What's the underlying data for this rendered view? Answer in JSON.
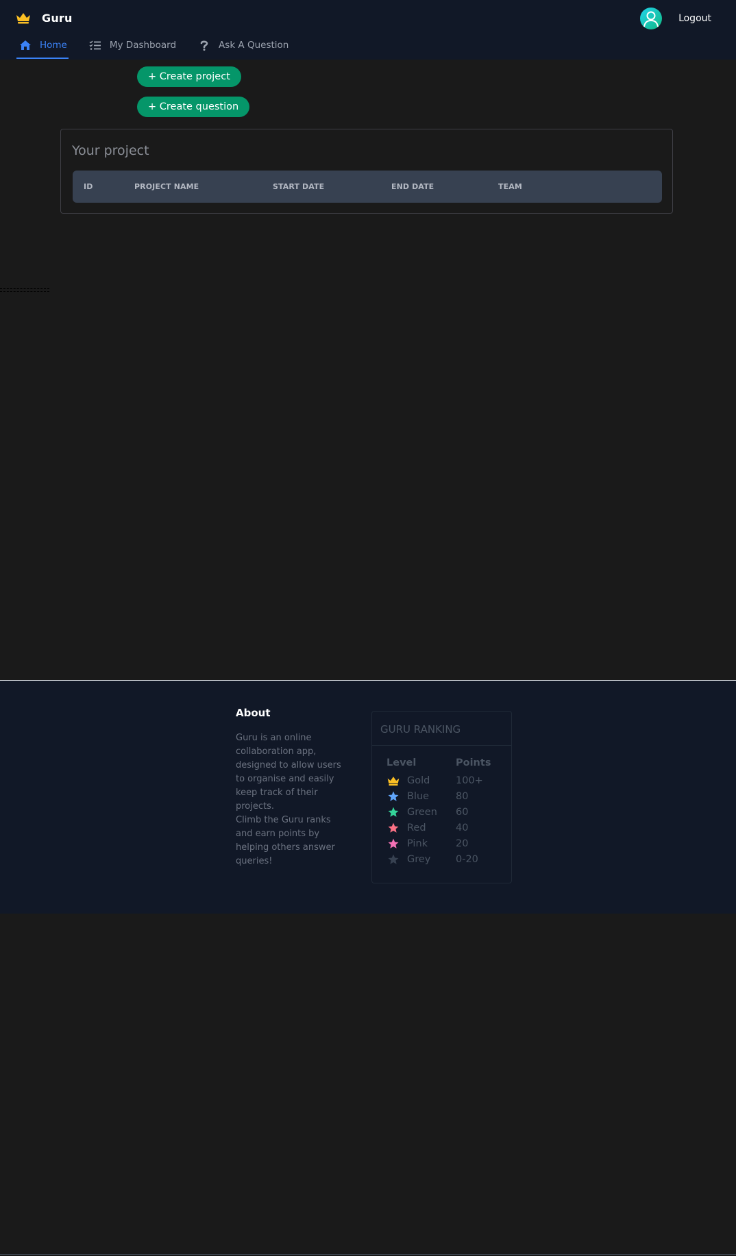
{
  "header": {
    "brand": "Guru",
    "logout_label": "Logout",
    "tabs": [
      {
        "label": "Home",
        "icon": "home-icon",
        "active": true
      },
      {
        "label": "My Dashboard",
        "icon": "checklist-icon",
        "active": false
      },
      {
        "label": "Ask A Question",
        "icon": "question-icon",
        "active": false
      }
    ]
  },
  "actions": {
    "create_project": "+ Create project",
    "create_question": "+ Create question"
  },
  "project": {
    "title": "Your project",
    "columns": [
      "ID",
      "PROJECT NAME",
      "START DATE",
      "END DATE",
      "TEAM"
    ],
    "rows": []
  },
  "footer": {
    "about_title": "About",
    "about_text_1": "Guru is an online collaboration app, designed to allow users to organise and easily keep track of their projects.",
    "about_text_2": "Climb the Guru ranks and earn points by helping others answer queries!",
    "ranking": {
      "title": "GURU RANKING",
      "level_header": "Level",
      "points_header": "Points",
      "levels": [
        {
          "name": "Gold",
          "points": "100+",
          "icon": "crown-icon",
          "color": "#fbbf24"
        },
        {
          "name": "Blue",
          "points": "80",
          "icon": "star-icon",
          "color": "#60a5fa"
        },
        {
          "name": "Green",
          "points": "60",
          "icon": "star-icon",
          "color": "#34d399"
        },
        {
          "name": "Red",
          "points": "40",
          "icon": "star-icon",
          "color": "#fb7185"
        },
        {
          "name": "Pink",
          "points": "20",
          "icon": "star-icon",
          "color": "#f472b6"
        },
        {
          "name": "Grey",
          "points": "0-20",
          "icon": "star-icon",
          "color": "#374151"
        }
      ]
    }
  },
  "colors": {
    "accent": "#3b82f6",
    "button_green": "#059669",
    "header_bg": "#111827",
    "page_bg": "#1a1a1a"
  }
}
